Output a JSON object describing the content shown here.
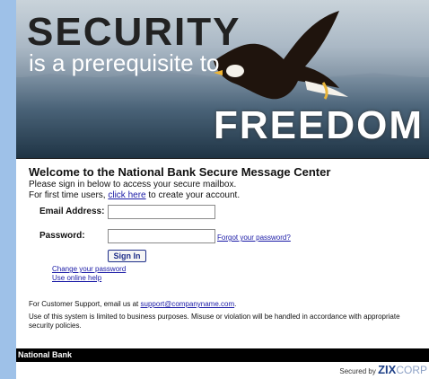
{
  "banner": {
    "line1": "SECURITY",
    "line2": "is a prerequisite to",
    "line3": "FREEDOM"
  },
  "welcome": {
    "title": "Welcome to the National Bank Secure Message Center",
    "line1": "Please sign in below to access your secure mailbox.",
    "first_time_prefix": "For first time users,",
    "click_here": "click here",
    "first_time_suffix": "to create your account."
  },
  "form": {
    "email_label": "Email Address:",
    "email_value": "",
    "password_label": "Password:",
    "password_value": "",
    "forgot_link": "Forgot your password?",
    "sign_in": "Sign In",
    "change_password": "Change your password",
    "online_help": "Use online help"
  },
  "support": {
    "prefix": "For Customer Support, email us at",
    "email": "support@companyname.com",
    "suffix": "."
  },
  "policy": "Use of this system is limited to business purposes. Misuse or violation will be handled in accordance with appropriate security policies.",
  "footer": {
    "bank_name": "National Bank",
    "secured_by": "Secured by",
    "brand_zix": "ZIX",
    "brand_corp": "CORP"
  }
}
